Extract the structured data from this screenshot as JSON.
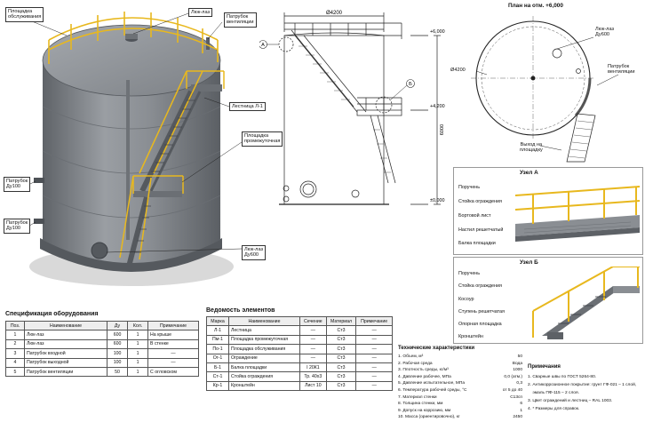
{
  "tank_callouts": {
    "service_platform": "Площадка\nобслуживания",
    "manhole_top": "Люк-лаз",
    "vent_pipe": "Патрубок\nвентиляции",
    "ladder": "Лестница Л-1",
    "mid_platform": "Площадка\nпромежуточная",
    "nozzle_1": "Патрубок\nДу100",
    "nozzle_2": "Патрубок\nДу100",
    "manhole_side": "Люк-лаз\nДу600"
  },
  "elevation": {
    "diameter": "Ø4200",
    "level_top": "+6,000",
    "level_mid": "+4,200",
    "level_zero": "±0,000",
    "height": "6000",
    "node_a": "А",
    "node_b": "Б"
  },
  "plan": {
    "title": "План на отм. +6,000",
    "diameter": "Ø4200",
    "manhole": "Люк-лаз\nДу600",
    "vent": "Патрубок\nвентиляции",
    "exit": "Выход на\nплощадку"
  },
  "node_a": {
    "title": "Узел А",
    "labels": [
      "Поручень",
      "Стойка ограждения",
      "Бортовой лист",
      "Настил решетчатый",
      "Балка площадки"
    ]
  },
  "node_b": {
    "title": "Узел Б",
    "labels": [
      "Поручень",
      "Стойка ограждения",
      "Косоур",
      "Ступень решетчатая",
      "Опорная площадка",
      "Кронштейн"
    ]
  },
  "equipment_spec": {
    "title": "Спецификация оборудования",
    "headers": [
      "Поз.",
      "Наименование",
      "Ду",
      "Кол.",
      "Примечание"
    ],
    "rows": [
      [
        "1",
        "Люк-лаз",
        "600",
        "1",
        "На крыше"
      ],
      [
        "2",
        "Люк-лаз",
        "600",
        "1",
        "В стенке"
      ],
      [
        "3",
        "Патрубок входной",
        "100",
        "1",
        "—"
      ],
      [
        "4",
        "Патрубок выходной",
        "100",
        "1",
        "—"
      ],
      [
        "5",
        "Патрубок вентиляции",
        "50",
        "1",
        "С огловском"
      ]
    ]
  },
  "elements_spec": {
    "title": "Ведомость элементов",
    "headers": [
      "Марка",
      "Наименование",
      "Сечение",
      "Материал",
      "Примечание"
    ],
    "rows": [
      [
        "Л-1",
        "Лестница",
        "—",
        "Ст3",
        "—"
      ],
      [
        "Пм-1",
        "Площадка промежуточная",
        "—",
        "Ст3",
        "—"
      ],
      [
        "По-1",
        "Площадка обслуживания",
        "—",
        "Ст3",
        "—"
      ],
      [
        "Ог-1",
        "Ограждение",
        "—",
        "Ст3",
        "—"
      ],
      [
        "Б-1",
        "Балка площадки",
        "I 20К1",
        "Ст3",
        "—"
      ],
      [
        "Ст-1",
        "Стойка ограждения",
        "Тр. 40х3",
        "Ст3",
        "—"
      ],
      [
        "Кр-1",
        "Кронштейн",
        "Лист 10",
        "Ст3",
        "—"
      ]
    ]
  },
  "tech_specs": {
    "title": "Технические характеристики",
    "items": [
      {
        "label": "1. Объем, м³",
        "value": "50"
      },
      {
        "label": "2. Рабочая среда",
        "value": "Вода"
      },
      {
        "label": "3. Плотность среды, кг/м³",
        "value": "1000"
      },
      {
        "label": "4. Давление рабочее, МПа",
        "value": "0,0 (атм.)"
      },
      {
        "label": "5. Давление испытательное, МПа",
        "value": "0,3"
      },
      {
        "label": "6. Температура рабочей среды, °С",
        "value": "от 5 до 40"
      },
      {
        "label": "7. Материал стенки",
        "value": "С13сп"
      },
      {
        "label": "8. Толщина стенки, мм",
        "value": "6"
      },
      {
        "label": "9. Допуск на коррозию, мм",
        "value": "1"
      },
      {
        "label": "10. Масса (ориентировочно), кг",
        "value": "2450"
      }
    ]
  },
  "notes": {
    "title": "Примечания",
    "items": [
      "1. Сварные швы по ГОСТ 5264-80.",
      "2. Антикоррозионное покрытие: грунт ГФ-021 – 1 слой,",
      "    эмаль ПФ-115 – 2 слоя.",
      "3. Цвет ограждений и лестниц – RAL 1003.",
      "4. * Размеры для справок."
    ]
  },
  "colors": {
    "tank_body": "#7b7f84",
    "railing": "#e8b81e",
    "line": "#222222"
  }
}
